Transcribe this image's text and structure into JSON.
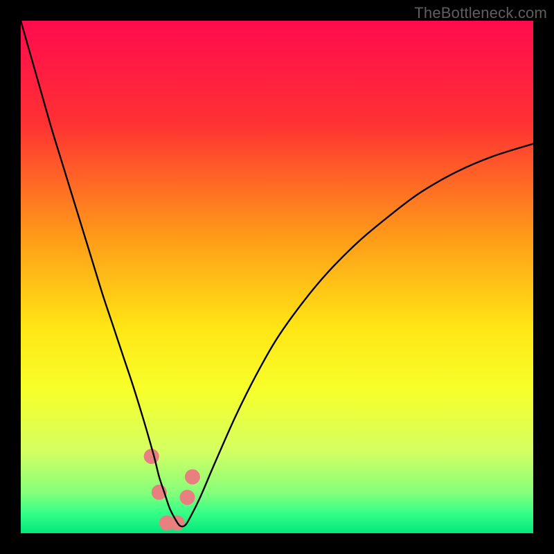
{
  "watermark": "TheBottleneck.com",
  "chart_data": {
    "type": "line",
    "title": "",
    "xlabel": "",
    "ylabel": "",
    "xlim": [
      0,
      100
    ],
    "ylim": [
      0,
      100
    ],
    "gradient_stops": [
      {
        "offset": 0.0,
        "color": "#ff0b4e"
      },
      {
        "offset": 0.2,
        "color": "#ff3133"
      },
      {
        "offset": 0.42,
        "color": "#ff9a19"
      },
      {
        "offset": 0.6,
        "color": "#ffe615"
      },
      {
        "offset": 0.72,
        "color": "#f7ff2a"
      },
      {
        "offset": 0.84,
        "color": "#d4ff62"
      },
      {
        "offset": 0.92,
        "color": "#86ff7a"
      },
      {
        "offset": 0.96,
        "color": "#36ff88"
      },
      {
        "offset": 1.0,
        "color": "#02e77b"
      }
    ],
    "series": [
      {
        "name": "bottleneck-curve",
        "stroke": "#000000",
        "stroke_width": 2.4,
        "x": [
          0,
          2,
          4,
          6,
          8,
          10,
          12,
          14,
          16,
          18,
          20,
          22,
          24,
          26,
          27,
          28,
          29,
          30,
          31,
          32,
          33,
          35,
          38,
          42,
          46,
          50,
          55,
          60,
          66,
          72,
          78,
          85,
          92,
          100
        ],
        "y": [
          100,
          93,
          86,
          79,
          72.5,
          66,
          59.5,
          53,
          46.5,
          40.5,
          34.5,
          28.5,
          22,
          15,
          11,
          8,
          5,
          3,
          1.5,
          1.5,
          3,
          7,
          14,
          23,
          31,
          38,
          45,
          51,
          57,
          62,
          66.5,
          70.5,
          73.5,
          76
        ]
      }
    ],
    "markers": [
      {
        "name": "marker-left-a",
        "x": 25.5,
        "y": 15,
        "color": "#e98080",
        "r": 11
      },
      {
        "name": "marker-left-b",
        "x": 27.0,
        "y": 8,
        "color": "#e98080",
        "r": 11
      },
      {
        "name": "marker-bottom-a",
        "x": 28.5,
        "y": 2,
        "color": "#e98080",
        "r": 11
      },
      {
        "name": "marker-bottom-b",
        "x": 30.5,
        "y": 2,
        "color": "#e98080",
        "r": 11
      },
      {
        "name": "marker-right-a",
        "x": 32.5,
        "y": 7,
        "color": "#e98080",
        "r": 11
      },
      {
        "name": "marker-right-b",
        "x": 33.5,
        "y": 11,
        "color": "#e98080",
        "r": 11
      }
    ]
  }
}
